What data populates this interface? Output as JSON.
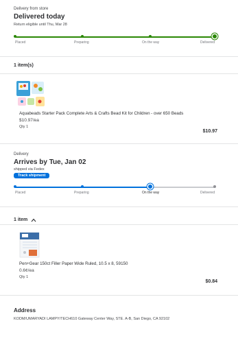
{
  "store_order": {
    "label": "Delivery from store",
    "status_title": "Delivered today",
    "return_text": "Return eligible until Thu, Mar 28",
    "steps": [
      "Placed",
      "Preparing",
      "On the way",
      "Delivered"
    ],
    "items_count": "1 item(s)",
    "item": {
      "name": "Aquabeads Starter Pack Complete Arts & Crafts Bead Kit for Children - over 650 Beads",
      "unit_price": "$10.97/ea",
      "qty": "Qty 1",
      "total": "$10.97"
    },
    "accent_color": "#2a8703"
  },
  "shipping_order": {
    "label": "Delivery",
    "status_title": "Arrives by Tue, Jan 02",
    "carrier": "shipped via Fedex",
    "track_button": "Track shipment",
    "steps": [
      "Placed",
      "Preparing",
      "On the way",
      "Delivered"
    ],
    "items_count": "1 item",
    "item": {
      "name": "Pen+Gear 150ct Filler Paper Wide Ruled, 10.5 x 8, 59150",
      "unit_price": "0.6¢/ea",
      "qty": "Qty 1",
      "total": "$0.84"
    },
    "accent_color": "#0071dc"
  },
  "address": {
    "heading": "Address",
    "line": "KODM/UMARYADI LAMPY/TECH610 Gateway Center Way, STE. A-B, San Diego, CA 92102"
  },
  "icons": {
    "collapse": "chevron-up-icon"
  }
}
